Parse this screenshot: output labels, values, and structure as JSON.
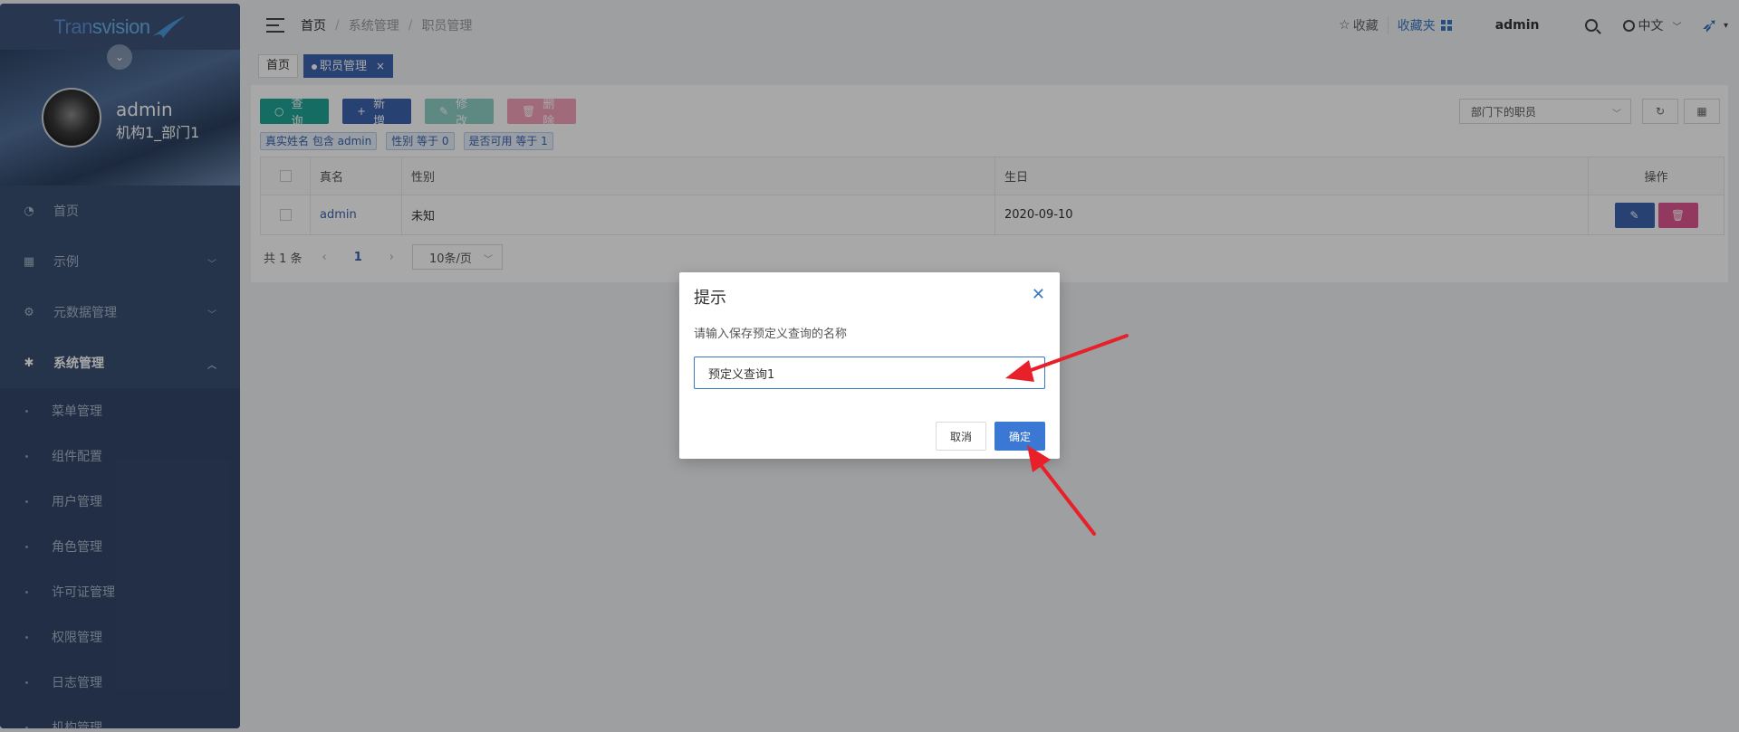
{
  "sidebar": {
    "logo_text_a": "Tran",
    "logo_text_b": "svision",
    "user_name": "admin",
    "user_org": "机构1_部门1",
    "menu": [
      {
        "label": "首页",
        "icon": "dashboard-icon"
      },
      {
        "label": "示例",
        "icon": "apps-icon"
      },
      {
        "label": "元数据管理",
        "icon": "metadata-icon"
      },
      {
        "label": "系统管理",
        "icon": "gear-icon"
      }
    ],
    "submenu": [
      "菜单管理",
      "组件配置",
      "用户管理",
      "角色管理",
      "许可证管理",
      "权限管理",
      "日志管理",
      "机构管理"
    ]
  },
  "header": {
    "breadcrumb": [
      "首页",
      "系统管理",
      "职员管理"
    ],
    "favorite": "收藏",
    "favorites_folder": "收藏夹",
    "user": "admin",
    "language": "中文"
  },
  "tabs": [
    {
      "label": "首页"
    },
    {
      "label": "职员管理"
    }
  ],
  "toolbar": {
    "query": "查询",
    "add": "新增",
    "edit": "修改",
    "delete": "删除",
    "dept_select": "部门下的职员"
  },
  "filters": [
    "真实姓名 包含 admin",
    "性别 等于 0",
    "是否可用 等于 1"
  ],
  "table": {
    "columns": [
      "真名",
      "性别",
      "生日",
      "操作"
    ],
    "rows": [
      {
        "name": "admin",
        "sex": "未知",
        "birthday": "2020-09-10"
      }
    ]
  },
  "pager": {
    "total": "共 1 条",
    "current": "1",
    "page_size": "10条/页"
  },
  "modal": {
    "title": "提示",
    "message": "请输入保存预定义查询的名称",
    "input_value": "预定义查询1",
    "cancel": "取消",
    "ok": "确定"
  },
  "colors": {
    "sidebar_bg": "#3b4f73",
    "primary": "#3b63ad",
    "query_green": "#21a595",
    "delete_pink": "#e05590",
    "annotation_red": "#e8202a"
  }
}
